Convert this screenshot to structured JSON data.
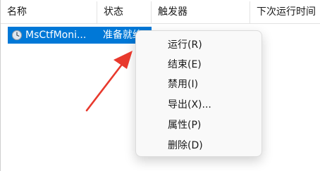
{
  "columns": [
    "名称",
    "状态",
    "触发器",
    "下次运行时间"
  ],
  "task": {
    "name": "MsCtfMoni...",
    "status": "准备就绪",
    "icon": "clock-icon"
  },
  "context_menu": {
    "items": [
      "运行(R)",
      "结束(E)",
      "禁用(I)",
      "导出(X)...",
      "属性(P)",
      "删除(D)"
    ]
  },
  "colors": {
    "selection": "#0078d7",
    "annotation_arrow": "#e8392d"
  }
}
